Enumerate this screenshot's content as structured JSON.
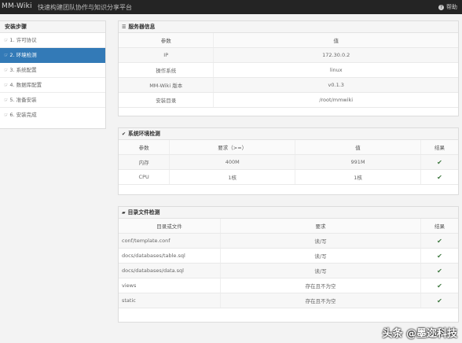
{
  "header": {
    "brand": "MM-Wiki",
    "subtitle": "快速构建团队协作与知识分享平台",
    "help_label": "帮助"
  },
  "sidebar": {
    "title": "安装步骤",
    "steps": [
      {
        "label": "1. 许可协议",
        "active": false
      },
      {
        "label": "2. 环境检测",
        "active": true
      },
      {
        "label": "3. 系统配置",
        "active": false
      },
      {
        "label": "4. 数据库配置",
        "active": false
      },
      {
        "label": "5. 准备安装",
        "active": false
      },
      {
        "label": "6. 安装完成",
        "active": false
      }
    ]
  },
  "server_info": {
    "title": "服务器信息",
    "headers": [
      "参数",
      "值"
    ],
    "rows": [
      [
        "IP",
        "172.30.0.2"
      ],
      [
        "操作系统",
        "linux"
      ],
      [
        "MM-Wiki 版本",
        "v0.1.3"
      ],
      [
        "安装目录",
        "/root/mmwiki"
      ]
    ]
  },
  "env_check": {
    "title": "系统环境检测",
    "headers": [
      "参数",
      "要求（>=）",
      "值",
      "结果"
    ],
    "rows": [
      [
        "内存",
        "400M",
        "991M"
      ],
      [
        "CPU",
        "1核",
        "1核"
      ]
    ]
  },
  "dir_check": {
    "title": "目录文件检测",
    "headers": [
      "目录或文件",
      "要求",
      "结果"
    ],
    "rows": [
      [
        "conf/template.conf",
        "读/写"
      ],
      [
        "docs/databases/table.sql",
        "读/写"
      ],
      [
        "docs/databases/data.sql",
        "读/写"
      ],
      [
        "views",
        "存在且不为空"
      ],
      [
        "static",
        "存在且不为空"
      ]
    ]
  },
  "watermark": "头条 @墨迩科技",
  "colors": {
    "accent": "#337ab7",
    "topbar": "#242424",
    "success": "#3c763d"
  },
  "icons": {
    "step": "hand-right-icon",
    "ok": "check-icon"
  }
}
